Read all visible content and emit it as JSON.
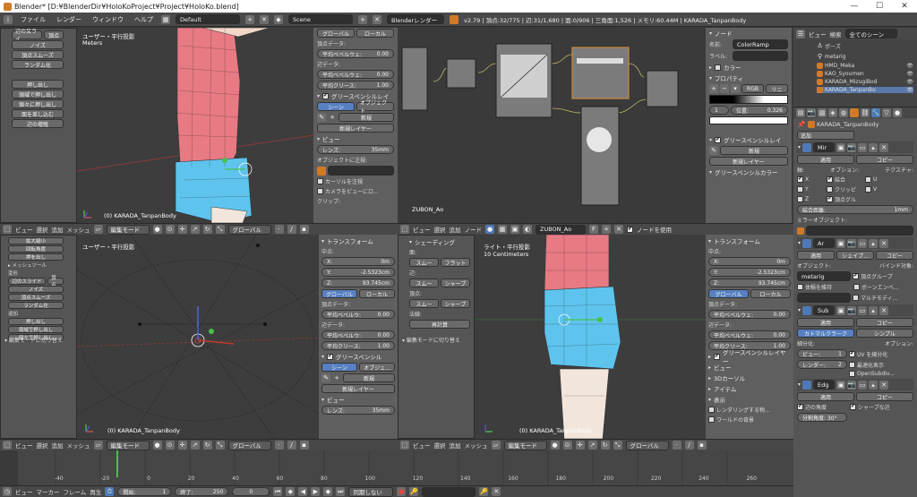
{
  "window": {
    "title": "Blender* [D:¥BlenderDir¥HoloKoProject¥Project¥HoloKo.blend]",
    "minimize": "—",
    "maximize": "☐",
    "close": "✕"
  },
  "topbar": {
    "menus": [
      "ファイル",
      "レンダー",
      "ウィンドウ",
      "ヘルプ"
    ],
    "layout": "Default",
    "scene": "Scene",
    "engine": "Blenderレンダー",
    "stats": "v2.79 | 頂点:32/775 | 辺:31/1,680 | 面:0/906 | 三角面:1,526 | メモリ:60.44M | KARADA_TanpanBody"
  },
  "toolshelf_top": {
    "items": [
      "辺の又ライ",
      "頂点",
      "ノイズ",
      "頂点スムーズ",
      "ランダム化"
    ],
    "items2": [
      "押し出し",
      "領域で押し出し",
      "個々に押し出し",
      "面を差し込む",
      "辺の増殖"
    ]
  },
  "toolshelf_bottom": {
    "items": [
      "拡大縮小",
      "回転角度",
      "押を出し",
      "▸ メッシュツール",
      "変形",
      "辺のスライド",
      "頂点",
      "ノイズ",
      "頂点スムーズ",
      "ランダム化",
      "追加",
      "押し出し",
      "領域で押し出し",
      "個々で押し出し"
    ]
  },
  "vp_tl": {
    "label": "ユーザー・平行投影",
    "units": "Meters",
    "object": "(0) KARADA_TanpanBody"
  },
  "vp_bl": {
    "label": "ユーザー・平行投影",
    "object": "(0) KARADA_TanpanBody",
    "op": "▾ 編集モードに切り替え"
  },
  "vp_br": {
    "label": "ライト・平行投影",
    "units": "10 Centimeters",
    "object": "(0) KARADA_TanpanBody"
  },
  "vp_tl_props": {
    "vertex_data": "頂点データ:",
    "mean_bevel": "平均ベベルウェ:",
    "mean_bevel_val": "0.00",
    "edge_data": "辺データ:",
    "edge_bevel": "平均ベベルウェ:",
    "edge_bevel_val": "0.00",
    "crease": "平均クリース:",
    "crease_val": "1.00",
    "gp_layer": "グリースペンシルレイ",
    "scene": "シーン",
    "object": "オブジェクト",
    "new": "新規",
    "new_layer": "新規レイヤー",
    "view": "ビュー",
    "lens": "レンズ:",
    "lens_val": "35mm",
    "lock_obj": "オブジェクトに注視:",
    "lock_cursor": "カーソルを注視",
    "lock_camera": "カメラをビューにロ...",
    "clip": "クリップ:",
    "global": "グローバル",
    "local": "ローカル"
  },
  "vp_bl_props": {
    "transform": "トランスフォーム",
    "median": "中点:",
    "x": "X:",
    "x_val": "0m",
    "y": "Y:",
    "y_val": "-2.5323cm",
    "z": "Z:",
    "z_val": "93.745cm",
    "global": "グローバル",
    "local": "ローカル",
    "vertex_data": "頂点データ:",
    "mean_bevel": "平均ベベルウ:",
    "mean_bevel_val": "0.00",
    "edge_data": "辺データ:",
    "edge_bevel": "平均ベベルウ:",
    "edge_bevel_val": "0.00",
    "crease": "平均クリース:",
    "crease_val": "1.00",
    "gp": "グリースペンシル",
    "scene": "シーン",
    "object": "オブジェ...",
    "new": "新規",
    "new_layer": "新規レイヤー",
    "view": "ビュー",
    "lens": "レンズ:",
    "lens_val": "35mm"
  },
  "shading_panel": {
    "title": "シェーディング",
    "face": "面:",
    "smooth": "スムー",
    "flat": "フラット",
    "edge": "辺:",
    "smooth2": "スムー",
    "sharp": "シャープ",
    "vertex": "頂点:",
    "smooth3": "スムー",
    "sharp2": "シャープ",
    "normal": "法線:",
    "recalc": "再計算",
    "op": "▾ 編集モードに切り替え"
  },
  "vp_br_props": {
    "transform": "トランスフォーム",
    "median": "中点:",
    "x": "X:",
    "x_val": "0m",
    "y": "Y:",
    "y_val": "-2.5323cm",
    "z": "Z:",
    "z_val": "93.745cm",
    "global": "グローバル",
    "local": "ローカル",
    "vertex_data": "頂点データ:",
    "mean_bevel": "平均ベベルウェ:",
    "mean_bevel_val": "0.00",
    "edge_data": "辺データ:",
    "edge_bevel": "平均ベベルウェ:",
    "edge_bevel_val": "0.00",
    "crease": "平均クリース:",
    "crease_val": "1.00",
    "gp": "グリースペンシルレイヤー",
    "view": "ビュー",
    "cursor": "3Dカーソル",
    "item": "アイテム",
    "display": "表示",
    "render_only": "レンダリングする物...",
    "world_bg": "ワールドの背景"
  },
  "node_editor": {
    "material": "ZUBON_Ao",
    "use_nodes": "ノードを使用",
    "menus": [
      "ビュー",
      "選択",
      "追加",
      "ノード"
    ],
    "f": "F"
  },
  "node_props": {
    "node": "ノード",
    "name": "名前:",
    "name_val": "ColorRamp",
    "label": "ラベル:",
    "color": "カラー",
    "properties": "プロパティ",
    "rgb": "RGB",
    "linear": "リニ",
    "index": "1",
    "pos_label": "位置:",
    "pos_val": "0.326",
    "gp_layer": "グリースペンシルレイ",
    "new": "新規",
    "new_layer": "新規レイヤー",
    "gp_color": "グリースペンシルカラー"
  },
  "outliner": {
    "view": "ビュー",
    "search": "検索",
    "scope": "全てのシーン",
    "items": [
      "ポーズ",
      "metarig",
      "HMD_Meka",
      "KAO_Syoumen",
      "KARADA_MizugiBod",
      "KARADA_TanpanBo"
    ]
  },
  "properties": {
    "object_name": "KARADA_TanpanBody",
    "add_modifier": "追加",
    "mods": [
      {
        "short": "Mir",
        "apply": "適用",
        "copy": "コピー"
      },
      {
        "short": "Ar",
        "apply": "適用",
        "copy": "シェイプ...",
        "copy2": "コピー"
      },
      {
        "short": "Sub",
        "apply": "適用",
        "copy": "コピー"
      },
      {
        "short": "Edg",
        "apply": "適用",
        "copy": "コピー"
      }
    ],
    "axis": "軸:",
    "options": "オプション:",
    "texture": "テクスチャ:",
    "x": "X",
    "y": "Y",
    "z": "Z",
    "merge": "結合",
    "clip": "クリッピ",
    "vgroup": "頂点グル",
    "u": "U",
    "v": "V",
    "merge_dist": "結合距離:",
    "merge_dist_val": "1mm",
    "mirror_obj": "ミラーオブジェクト:",
    "object": "オブジェクト:",
    "bind_to": "バインド対象:",
    "metarig": "metarig",
    "vgroups": "頂点グループ",
    "keep_vol": "体積を維持",
    "bone_env": "ボーンエンベ...",
    "multi": "マルチモディ...",
    "catmull": "カトマルクラーク",
    "simple": "シンプル",
    "subdiv": "細分化:",
    "view": "ビュー:",
    "view_val": "1",
    "render": "レンダー:",
    "render_val": "2",
    "uv_smooth": "UV を線分化",
    "optimal": "最適化表示",
    "opensubdiv": "OpenSubdiv...",
    "edge_angle": "辺の角度",
    "sharp_edge": "シャープな辺",
    "split_angle": "分割角度: 30°"
  },
  "vp_header": {
    "view": "ビュー",
    "select": "選択",
    "add": "追加",
    "mesh": "メッシュ",
    "mode": "編集モード",
    "global": "グローバル"
  },
  "timeline": {
    "view": "ビュー",
    "marker": "マーカー",
    "frame": "フレーム",
    "play": "再生",
    "start": "開始:",
    "start_val": "1",
    "end": "終了:",
    "end_val": "250",
    "current": "0",
    "sync": "同期しない",
    "ticks": [
      "-40",
      "-20",
      "0",
      "20",
      "40",
      "60",
      "80",
      "100",
      "120",
      "140",
      "160",
      "180",
      "200",
      "220",
      "240",
      "260"
    ]
  }
}
